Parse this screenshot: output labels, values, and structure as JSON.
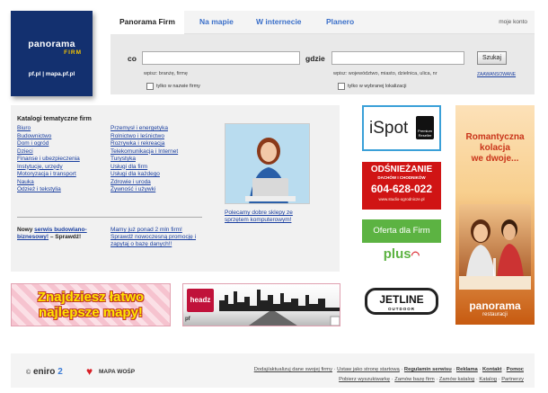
{
  "logo": {
    "line1": "panorama",
    "line2": "FIRM",
    "line3": "pf.pl  |  mapa.pf.pl"
  },
  "nav": {
    "tabs": [
      "Panorama Firm",
      "Na mapie",
      "W internecie",
      "Planero"
    ],
    "account": "moje konto"
  },
  "search": {
    "what_label": "co",
    "what_hint": "wpisz: branżę, firmę",
    "where_label": "gdzie",
    "where_hint": "wpisz: województwo, miasto, dzielnica, ulica, nr",
    "only_name": "tylko w nazwie firmy",
    "only_location": "tylko w wybranej lokalizacji",
    "button": "Szukaj",
    "advanced": "ZAAWANSOWANE"
  },
  "catalog": {
    "title": "Katalogi tematyczne firm",
    "col1": [
      "Biuro",
      "Budownictwo",
      "Dom i ogród",
      "Dzieci",
      "Finanse i ubezpieczenia",
      "Instytucje, urzędy",
      "Motoryzacja i transport",
      "Nauka",
      "Odzież i tekstylia"
    ],
    "col2": [
      "Przemysł i energetyka",
      "Rolnictwo i leśnictwo",
      "Rozrywka i rekreacja",
      "Telekomunikacja i Internet",
      "Turystyka",
      "Usługi dla firm",
      "Usługi dla każdego",
      "Zdrowie i uroda",
      "Żywność i używki"
    ],
    "promo_prefix": "Nowy",
    "promo_link": "serwis budowlano-biznesowy!",
    "promo_suffix": " – Sprawdź!",
    "promo2": "Mamy już ponad 2 mln firm! Sprawdź nowoczesną promocję i zapytaj o bazę danych!!",
    "photo_caption": "Polecamy dobre sklepy ze sprzętem komputerowym!"
  },
  "banners": {
    "map_line1": "Znajdziesz łatwo",
    "map_line2": "najlepsze mapy!",
    "headz": "headz",
    "headz_sub": "pf"
  },
  "ads": {
    "ispot": "iSpot",
    "ispot_badge": "Premium Reseller",
    "odsn_1": "ODŚNIEŻANIE",
    "odsn_2": "DACHÓW I CHODNIKÓW",
    "odsn_phone": "604-628-022",
    "odsn_url": "www.studio-ogrodnicze.pl",
    "plus_top": "Oferta dla Firm",
    "plus_logo": "plus",
    "jetline_1": "JETLINE",
    "jetline_2": "OUTDOOR",
    "roman_1": "Romantyczna",
    "roman_2": "kolacja",
    "roman_3": "we dwoje...",
    "roman_brand": "panorama",
    "roman_sub": "restauracji"
  },
  "footer": {
    "eniro": "eniro",
    "wosp": "MAPA WOŚP",
    "row1": [
      "Dodaj/aktualizuj dane swojej firmy",
      "Ustaw jako stronę startową",
      "Regulamin serwisu",
      "Reklama",
      "Kontakt",
      "Pomoc"
    ],
    "row2": [
      "Pobierz wyszukiwarkę",
      "Zamów bazę firm",
      "Zamów katalog",
      "Katalog",
      "Partnerzy"
    ]
  }
}
